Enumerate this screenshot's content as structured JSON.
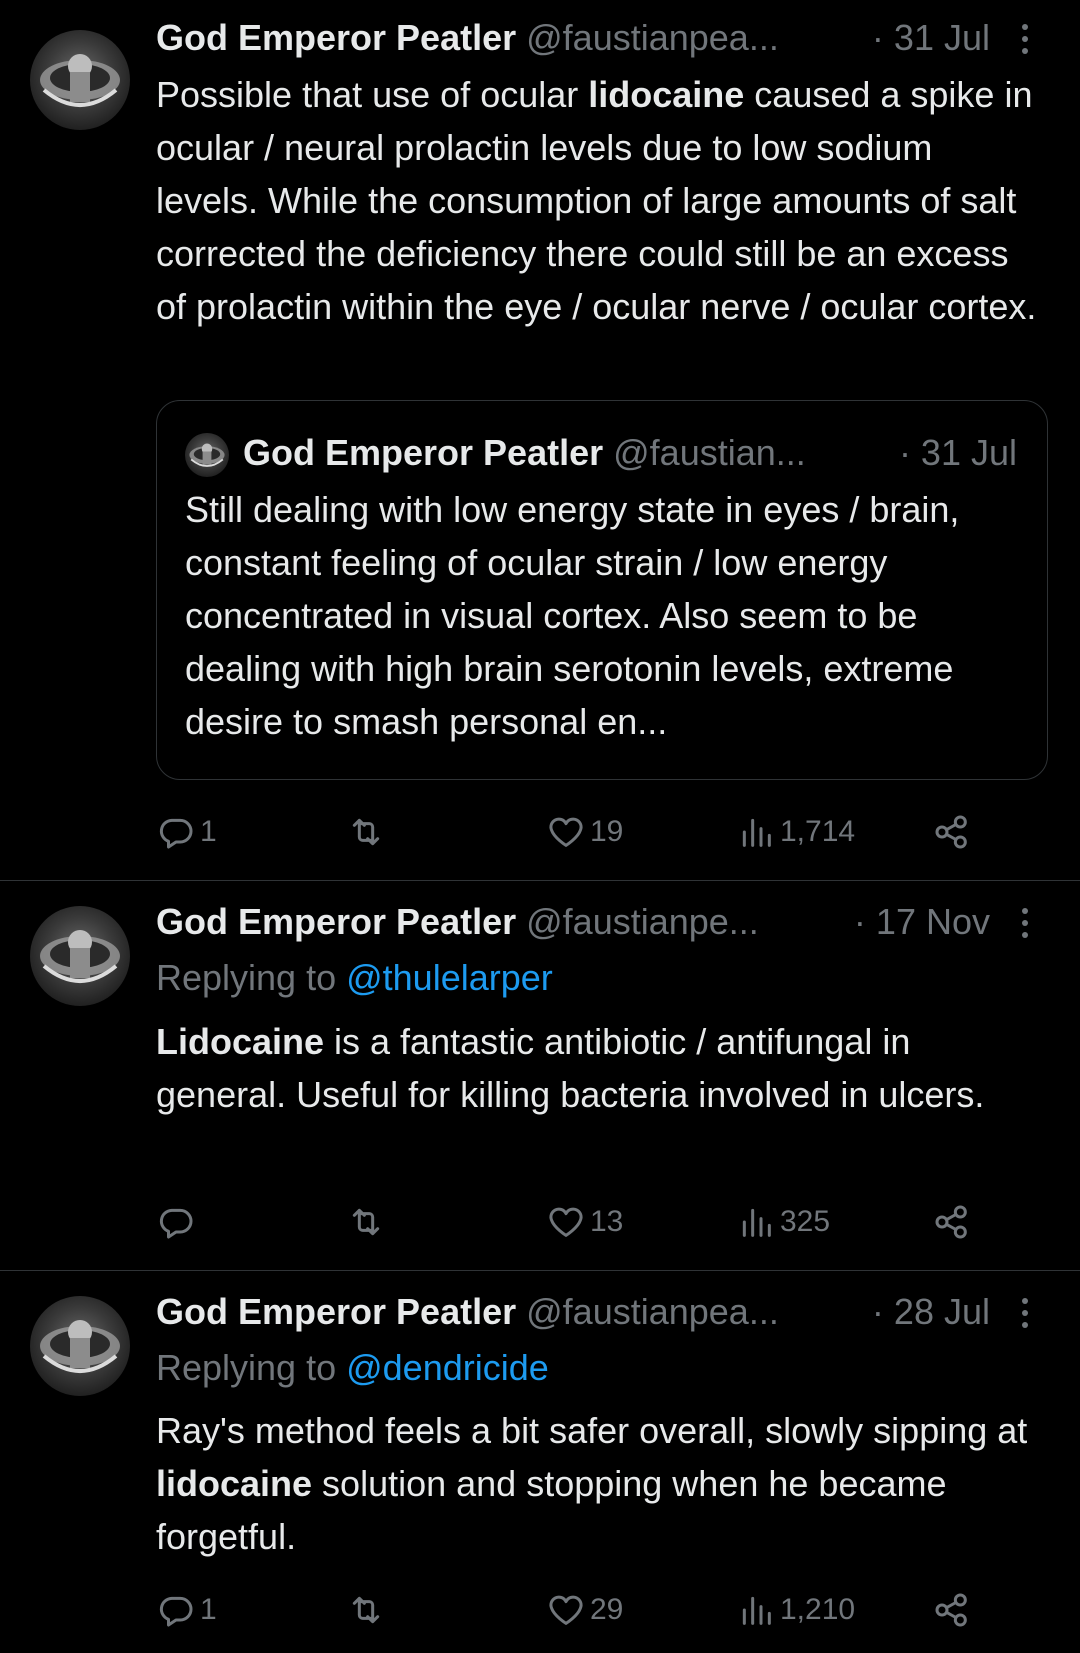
{
  "tweets": [
    {
      "name": "God Emperor Peatler",
      "handle": "@faustianpea...",
      "dot": "·",
      "date": "31 Jul",
      "replying_to": "",
      "body_parts": [
        {
          "text": "Possible that use of ocular ",
          "bold": false
        },
        {
          "text": "lidocaine",
          "bold": true
        },
        {
          "text": " caused a spike in ocular / neural prolactin levels due to low sodium levels. While the consumption of large amounts of salt corrected the deficiency there could still be an excess of prolactin within the eye / ocular nerve / ocular cortex.",
          "bold": false
        }
      ],
      "quote": {
        "name": "God Emperor Peatler",
        "handle": "@faustian...",
        "date": "· 31 Jul",
        "body": "Still dealing with low energy state in eyes / brain, constant feeling of ocular strain / low energy concentrated in visual cortex. Also seem to be dealing with high brain serotonin levels, extreme desire to smash personal en..."
      },
      "stats": {
        "replies": "1",
        "retweets": "",
        "likes": "19",
        "views": "1,714"
      }
    },
    {
      "name": "God Emperor Peatler",
      "handle": "@faustianpe...",
      "dot": "·",
      "date": "17 Nov",
      "replying_to_prefix": "Replying to ",
      "replying_to": "@thulelarper",
      "body_parts": [
        {
          "text": "Lidocaine",
          "bold": true
        },
        {
          "text": " is a fantastic antibiotic / antifungal in general. Useful for killing bacteria involved in ulcers.",
          "bold": false
        }
      ],
      "stats": {
        "replies": "",
        "retweets": "",
        "likes": "13",
        "views": "325"
      }
    },
    {
      "name": "God Emperor Peatler",
      "handle": "@faustianpea...",
      "dot": "·",
      "date": "28 Jul",
      "replying_to_prefix": "Replying to ",
      "replying_to": "@dendricide",
      "body_parts": [
        {
          "text": "Ray's method feels a bit safer overall, slowly sipping at ",
          "bold": false
        },
        {
          "text": "lidocaine",
          "bold": true
        },
        {
          "text": " solution and stopping when he became forgetful.",
          "bold": false
        }
      ],
      "stats": {
        "replies": "1",
        "retweets": "",
        "likes": "29",
        "views": "1,210"
      }
    }
  ],
  "icons": {
    "reply": "reply-icon",
    "retweet": "retweet-icon",
    "like": "heart-icon",
    "views": "views-icon",
    "share": "share-icon",
    "more": "more-icon"
  },
  "colors": {
    "background": "#000000",
    "text": "#e7e9ea",
    "muted": "#71767b",
    "link": "#1d9bf0",
    "divider": "#2f3336"
  }
}
